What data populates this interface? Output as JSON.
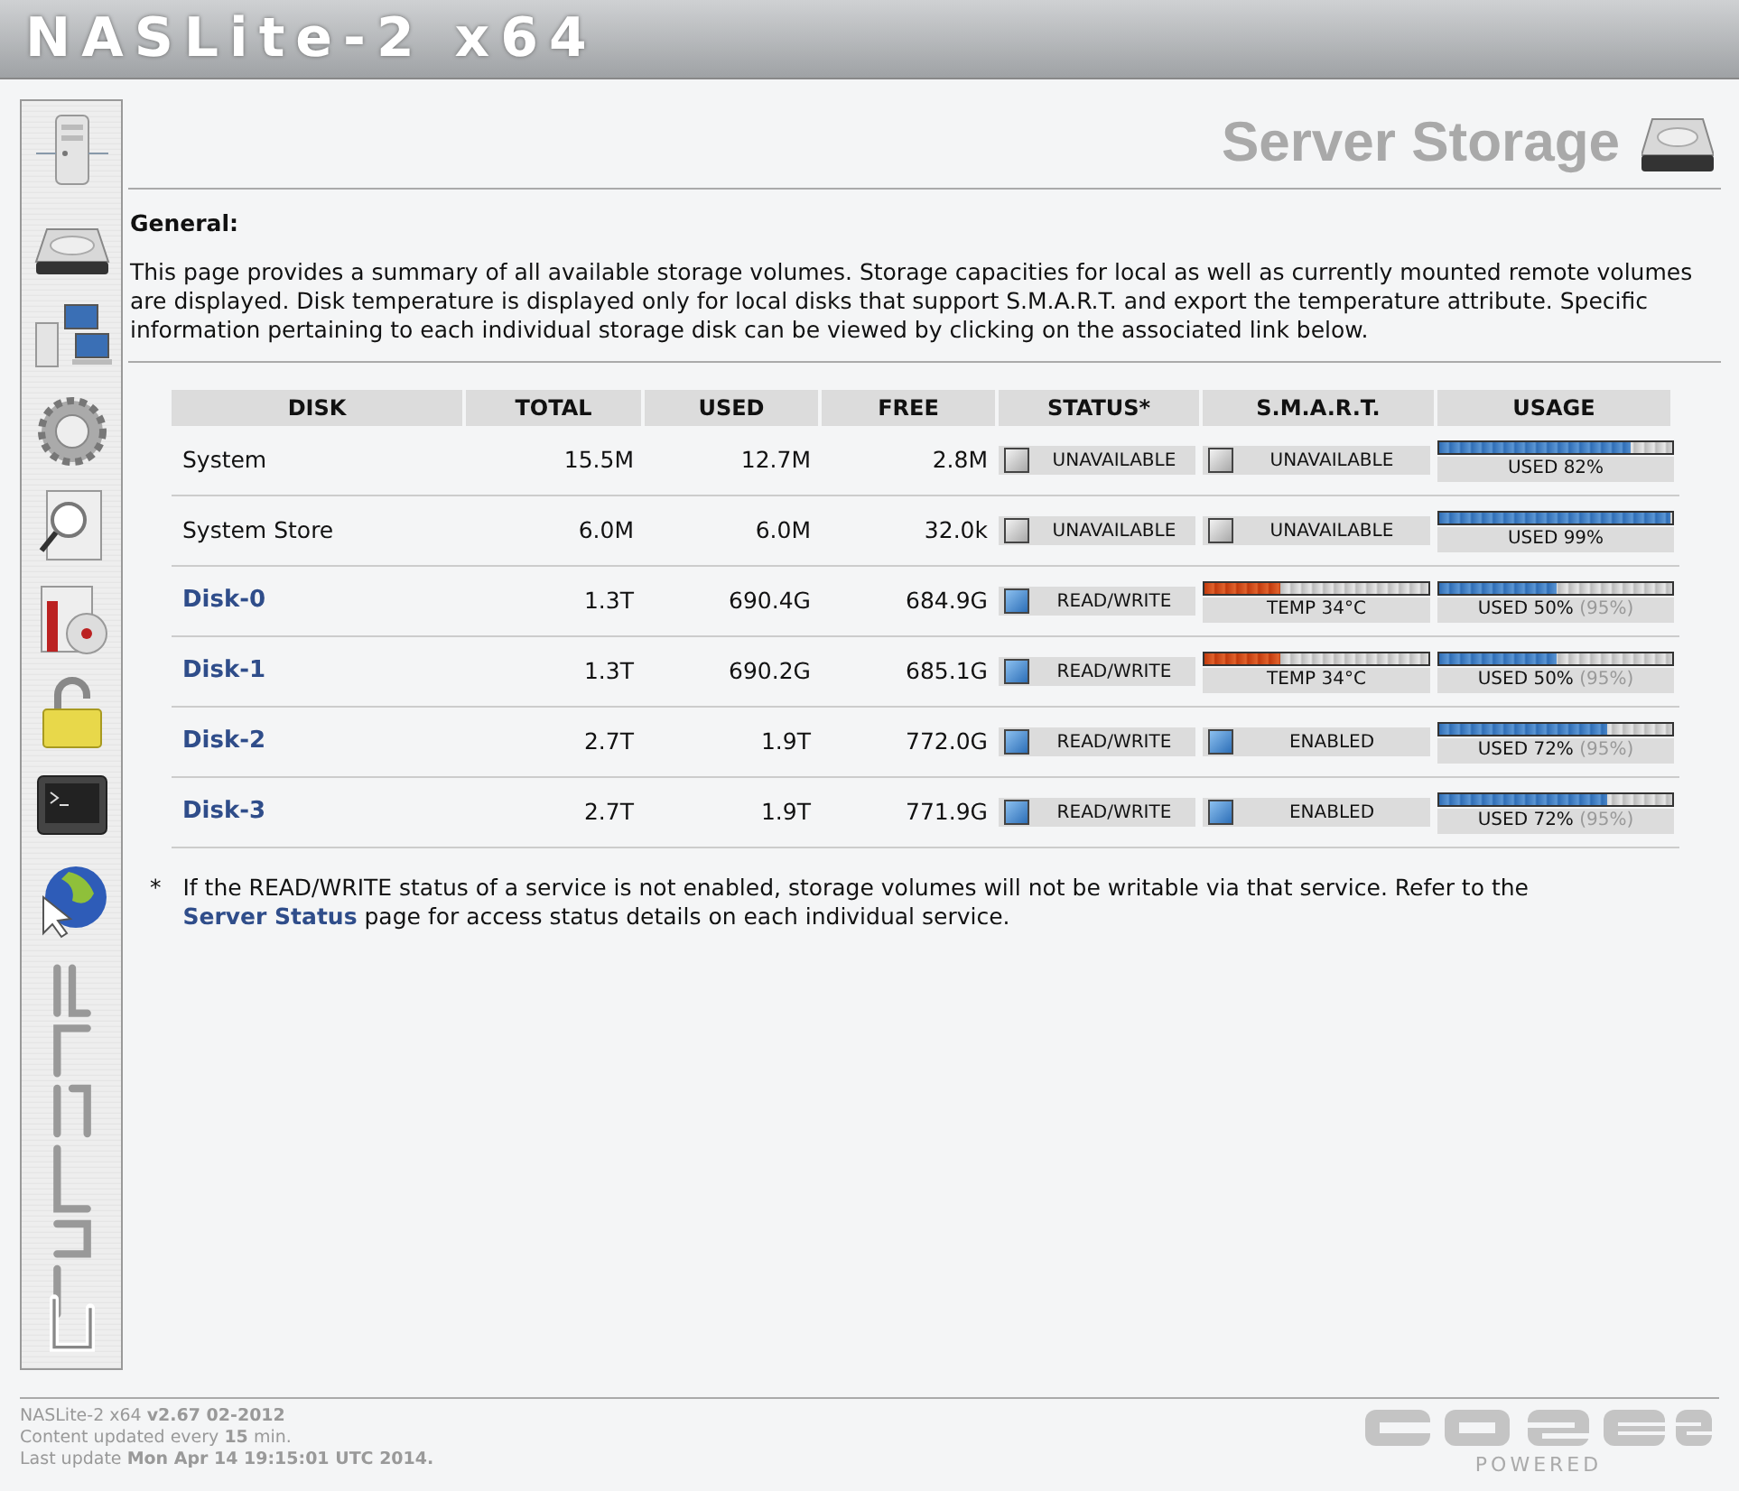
{
  "header": {
    "title": "NASLite-2 x64"
  },
  "page": {
    "title": "Server Storage",
    "section": "General:",
    "description": "This page provides a summary of all available storage volumes. Storage capacities for local as well as currently mounted remote volumes are displayed. Disk temperature is displayed only for local disks that support S.M.A.R.T. and export the temperature attribute. Specific information pertaining to each individual storage disk can be viewed by clicking on the associated link below."
  },
  "table": {
    "columns": [
      "DISK",
      "TOTAL",
      "USED",
      "FREE",
      "STATUS*",
      "S.M.A.R.T.",
      "USAGE"
    ],
    "rows": [
      {
        "disk": "System",
        "link": false,
        "total": "15.5M",
        "used": "12.7M",
        "free": "2.8M",
        "status": {
          "label": "UNAVAILABLE",
          "active": false
        },
        "smart": {
          "kind": "indicator",
          "label": "UNAVAILABLE",
          "active": false
        },
        "usage": {
          "level": 0.82,
          "label": "USED 82%"
        }
      },
      {
        "disk": "System Store",
        "link": false,
        "total": "6.0M",
        "used": "6.0M",
        "free": "32.0k",
        "status": {
          "label": "UNAVAILABLE",
          "active": false
        },
        "smart": {
          "kind": "indicator",
          "label": "UNAVAILABLE",
          "active": false
        },
        "usage": {
          "level": 0.99,
          "label": "USED 99%"
        }
      },
      {
        "disk": "Disk-0",
        "link": true,
        "total": "1.3T",
        "used": "690.4G",
        "free": "684.9G",
        "status": {
          "label": "READ/WRITE",
          "active": true
        },
        "smart": {
          "kind": "meter",
          "label": "TEMP 34°C",
          "level": 0.34
        },
        "usage": {
          "level": 0.5,
          "label": "USED 50%",
          "note": "(95%)"
        }
      },
      {
        "disk": "Disk-1",
        "link": true,
        "total": "1.3T",
        "used": "690.2G",
        "free": "685.1G",
        "status": {
          "label": "READ/WRITE",
          "active": true
        },
        "smart": {
          "kind": "meter",
          "label": "TEMP 34°C",
          "level": 0.34
        },
        "usage": {
          "level": 0.5,
          "label": "USED 50%",
          "note": "(95%)"
        }
      },
      {
        "disk": "Disk-2",
        "link": true,
        "total": "2.7T",
        "used": "1.9T",
        "free": "772.0G",
        "status": {
          "label": "READ/WRITE",
          "active": true
        },
        "smart": {
          "kind": "indicator",
          "label": "ENABLED",
          "active": true
        },
        "usage": {
          "level": 0.72,
          "label": "USED 72%",
          "note": "(95%)"
        }
      },
      {
        "disk": "Disk-3",
        "link": true,
        "total": "2.7T",
        "used": "1.9T",
        "free": "771.9G",
        "status": {
          "label": "READ/WRITE",
          "active": true
        },
        "smart": {
          "kind": "indicator",
          "label": "ENABLED",
          "active": true
        },
        "usage": {
          "level": 0.72,
          "label": "USED 72%",
          "note": "(95%)"
        }
      }
    ]
  },
  "footnote": {
    "mark": "*",
    "text": "If the READ/WRITE status of a service is not enabled, storage volumes will not be writable via that service. Refer to the",
    "link": "Server Status",
    "after": "page for access status details on each individual service."
  },
  "footer": {
    "lines": [
      "NASLite-2 x64 **v2.67 02-2012**",
      "Content updated every **15** min.",
      "Last update **Mon Apr 14 19:15:01 UTC 2014.**"
    ],
    "badge": "POWERED"
  }
}
